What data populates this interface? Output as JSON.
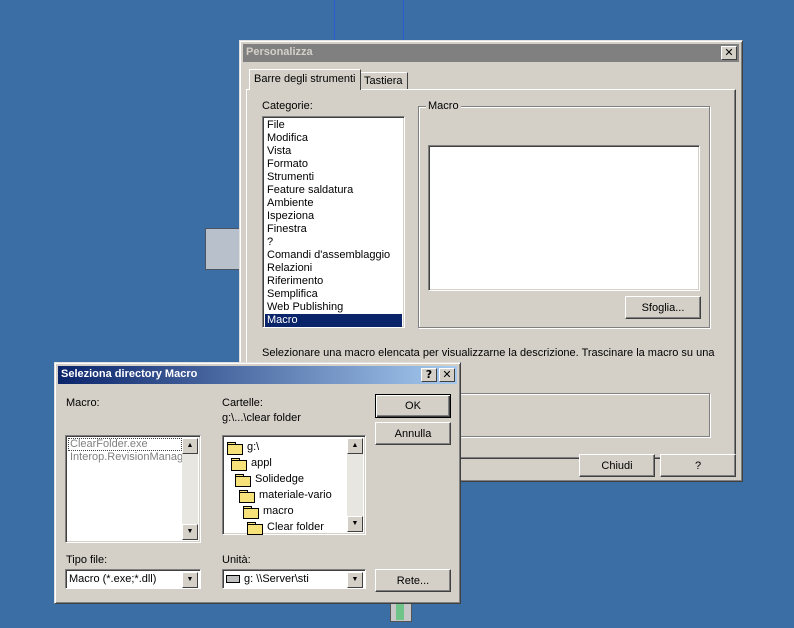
{
  "personalizza": {
    "title": "Personalizza",
    "close_label": "✕",
    "tabs": [
      {
        "label": "Barre degli strumenti"
      },
      {
        "label": "Tastiera"
      }
    ],
    "categorie_label": "Categorie:",
    "categories": [
      "File",
      "Modifica",
      "Vista",
      "Formato",
      "Strumenti",
      "Feature saldatura",
      "Ambiente",
      "Ispeziona",
      "Finestra",
      "?",
      "Comandi d'assemblaggio",
      "Relazioni",
      "Riferimento",
      "Semplifica",
      "Web Publishing",
      "Macro"
    ],
    "selected_category": "Macro",
    "macro_group_label": "Macro",
    "sfoglia_label": "Sfoglia...",
    "description": "Selezionare una macro elencata per visualizzarne la descrizione. Trascinare la macro su una",
    "chiudi_label": "Chiudi",
    "help_label": "?"
  },
  "seleziona": {
    "title": "Seleziona directory Macro",
    "help_label": "?",
    "close_label": "✕",
    "macro_label": "Macro:",
    "macro_files": [
      "ClearFolder.exe",
      "Interop.RevisionManag"
    ],
    "cartelle_label": "Cartelle:",
    "current_path": "g:\\...\\clear folder",
    "folders": [
      "g:\\",
      "appl",
      "Solidedge",
      "materiale-vario",
      "macro",
      "Clear folder"
    ],
    "ok_label": "OK",
    "annulla_label": "Annulla",
    "tipo_label": "Tipo file:",
    "tipo_value": "Macro (*.exe;*.dll)",
    "unita_label": "Unità:",
    "unita_value": "g: \\\\Server\\sti",
    "rete_label": "Rete..."
  },
  "colors": {
    "desktop": "#3a6ea5",
    "active_title": "#0a246a",
    "inactive_title": "#808080",
    "face": "#d4d0c8"
  }
}
